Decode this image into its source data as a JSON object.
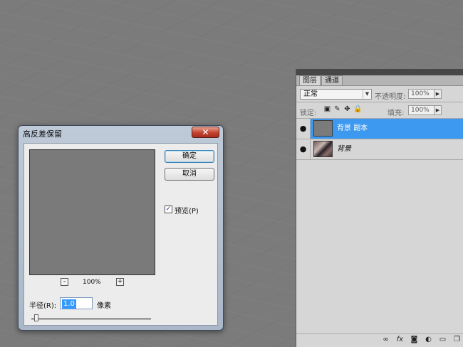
{
  "layers_panel": {
    "tabs": [
      {
        "label": "图层"
      },
      {
        "label": "通道"
      }
    ],
    "blend_mode": "正常",
    "opacity": {
      "label": "不透明度:",
      "value": "100%"
    },
    "lock": {
      "label": "锁定:"
    },
    "fill": {
      "label": "填充:",
      "value": "100%"
    },
    "layers": [
      {
        "name": "背景 副本",
        "selected": true
      },
      {
        "name": "背景",
        "selected": false
      }
    ],
    "footer_icons": [
      "link-icon",
      "fx-icon",
      "mask-icon",
      "adjustment-icon",
      "group-icon",
      "new-layer-icon"
    ]
  },
  "dialog": {
    "title": "高反差保留",
    "ok_label": "确定",
    "cancel_label": "取消",
    "preview_label": "预览(P)",
    "preview_checked": true,
    "zoom_minus": "-",
    "zoom_level": "100%",
    "zoom_plus": "+",
    "radius_label": "半径(R):",
    "radius_value": "1.0",
    "unit_label": "像素",
    "slider_level": 0.03
  },
  "colors": {
    "selection": "#3d98f0",
    "canvas": "#7b7b7b",
    "close_button": "#c3412f"
  }
}
